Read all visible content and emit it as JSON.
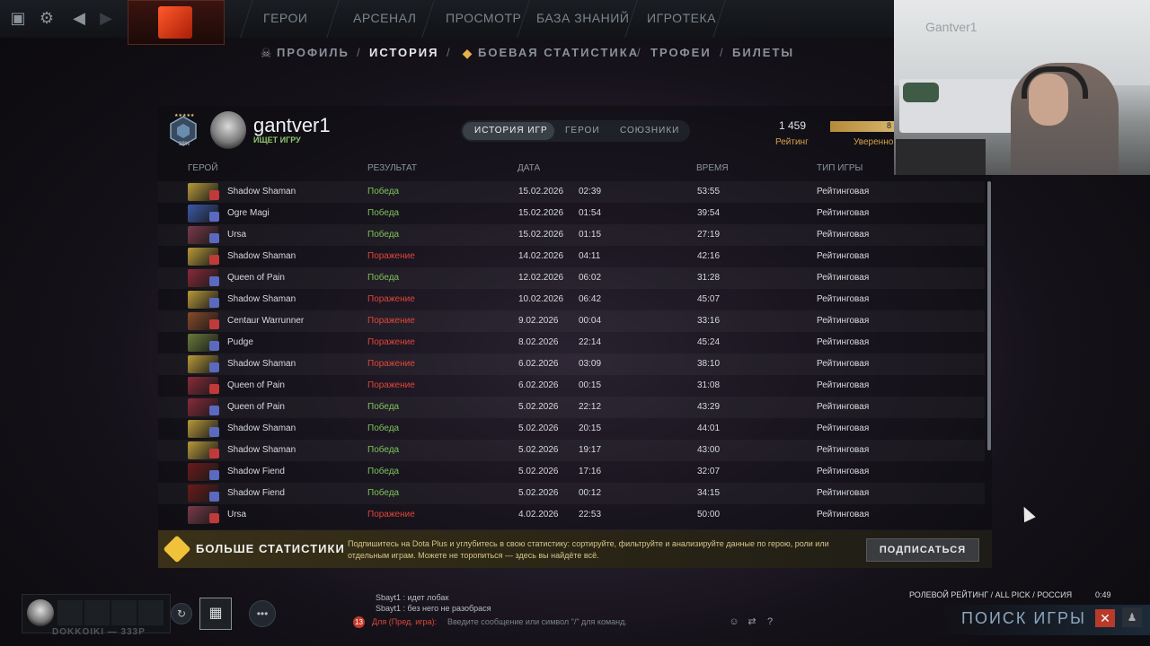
{
  "topnav": {
    "items": [
      "ГЕРОИ",
      "АРСЕНАЛ",
      "ПРОСМОТР",
      "БАЗА ЗНАНИЙ",
      "ИГРОТЕКА"
    ]
  },
  "subnav": {
    "items": [
      "ПРОФИЛЬ",
      "ИСТОРИЯ",
      "БОЕВАЯ СТАТИСТИКА",
      "ТРОФЕИ",
      "БИЛЕТЫ"
    ],
    "active": "ИСТОРИЯ"
  },
  "profile": {
    "username": "gantver1",
    "status": "ИЩЕТ ИГРУ",
    "rank_pct": "38%",
    "rating": "1 459",
    "rating_label": "Рейтинг",
    "confidence_label": "Уверенно",
    "confidence_value": "8"
  },
  "tabs": [
    "ИСТОРИЯ ИГР",
    "ГЕРОИ",
    "СОЮЗНИКИ"
  ],
  "columns": {
    "hero": "ГЕРОЙ",
    "result": "РЕЗУЛЬТАТ",
    "date": "ДАТА",
    "time": "ВРЕМЯ",
    "type": "ТИП ИГРЫ"
  },
  "matches": [
    {
      "hero": "Shadow Shaman",
      "result": "Победа",
      "date": "15.02.2026",
      "clock": "02:39",
      "dur": "53:55",
      "type": "Рейтинговая",
      "win": true
    },
    {
      "hero": "Ogre Magi",
      "result": "Победа",
      "date": "15.02.2026",
      "clock": "01:54",
      "dur": "39:54",
      "type": "Рейтинговая",
      "win": true
    },
    {
      "hero": "Ursa",
      "result": "Победа",
      "date": "15.02.2026",
      "clock": "01:15",
      "dur": "27:19",
      "type": "Рейтинговая",
      "win": true
    },
    {
      "hero": "Shadow Shaman",
      "result": "Поражение",
      "date": "14.02.2026",
      "clock": "04:11",
      "dur": "42:16",
      "type": "Рейтинговая",
      "win": false
    },
    {
      "hero": "Queen of Pain",
      "result": "Победа",
      "date": "12.02.2026",
      "clock": "06:02",
      "dur": "31:28",
      "type": "Рейтинговая",
      "win": true
    },
    {
      "hero": "Shadow Shaman",
      "result": "Поражение",
      "date": "10.02.2026",
      "clock": "06:42",
      "dur": "45:07",
      "type": "Рейтинговая",
      "win": false
    },
    {
      "hero": "Centaur Warrunner",
      "result": "Поражение",
      "date": "9.02.2026",
      "clock": "00:04",
      "dur": "33:16",
      "type": "Рейтинговая",
      "win": false
    },
    {
      "hero": "Pudge",
      "result": "Поражение",
      "date": "8.02.2026",
      "clock": "22:14",
      "dur": "45:24",
      "type": "Рейтинговая",
      "win": false
    },
    {
      "hero": "Shadow Shaman",
      "result": "Поражение",
      "date": "6.02.2026",
      "clock": "03:09",
      "dur": "38:10",
      "type": "Рейтинговая",
      "win": false
    },
    {
      "hero": "Queen of Pain",
      "result": "Поражение",
      "date": "6.02.2026",
      "clock": "00:15",
      "dur": "31:08",
      "type": "Рейтинговая",
      "win": false
    },
    {
      "hero": "Queen of Pain",
      "result": "Победа",
      "date": "5.02.2026",
      "clock": "22:12",
      "dur": "43:29",
      "type": "Рейтинговая",
      "win": true
    },
    {
      "hero": "Shadow Shaman",
      "result": "Победа",
      "date": "5.02.2026",
      "clock": "20:15",
      "dur": "44:01",
      "type": "Рейтинговая",
      "win": true
    },
    {
      "hero": "Shadow Shaman",
      "result": "Победа",
      "date": "5.02.2026",
      "clock": "19:17",
      "dur": "43:00",
      "type": "Рейтинговая",
      "win": true
    },
    {
      "hero": "Shadow Fiend",
      "result": "Победа",
      "date": "5.02.2026",
      "clock": "17:16",
      "dur": "32:07",
      "type": "Рейтинговая",
      "win": true
    },
    {
      "hero": "Shadow Fiend",
      "result": "Победа",
      "date": "5.02.2026",
      "clock": "00:12",
      "dur": "34:15",
      "type": "Рейтинговая",
      "win": true
    },
    {
      "hero": "Ursa",
      "result": "Поражение",
      "date": "4.02.2026",
      "clock": "22:53",
      "dur": "50:00",
      "type": "Рейтинговая",
      "win": false
    }
  ],
  "hero_colors": {
    "Shadow Shaman": "#b89a3a",
    "Ogre Magi": "#3a5aa8",
    "Ursa": "#7a3a4a",
    "Queen of Pain": "#8a2a3a",
    "Centaur Warrunner": "#8a4a2a",
    "Pudge": "#6a7a3a",
    "Shadow Fiend": "#6a1a1a"
  },
  "plus": {
    "title": "БОЛЬШЕ СТАТИСТИКИ",
    "text": "Подпишитесь на Dota Plus и углубитесь в свою статистику: сортируйте, фильтруйте и анализируйте данные по герою, роли или отдельным играм. Можете не торопиться — здесь вы найдёте всё.",
    "button": "ПОДПИСАТЬСЯ"
  },
  "party": {
    "name": "DOKKOIKI — 333P"
  },
  "chat": {
    "lines": [
      "Sbayt1 : идет лобак",
      "Sbayt1 : без него не разобрася"
    ],
    "unread": "13",
    "channel": "Для (Пред. игра):",
    "placeholder": "Введите сообщение или символ \"/\" для команд."
  },
  "queue": {
    "info": "РОЛЕВОЙ РЕЙТИНГ / ALL PICK / РОССИЯ",
    "time": "0:49",
    "label": "ПОИСК ИГРЫ"
  },
  "webcam": {
    "wall_text": "Gantver1"
  }
}
